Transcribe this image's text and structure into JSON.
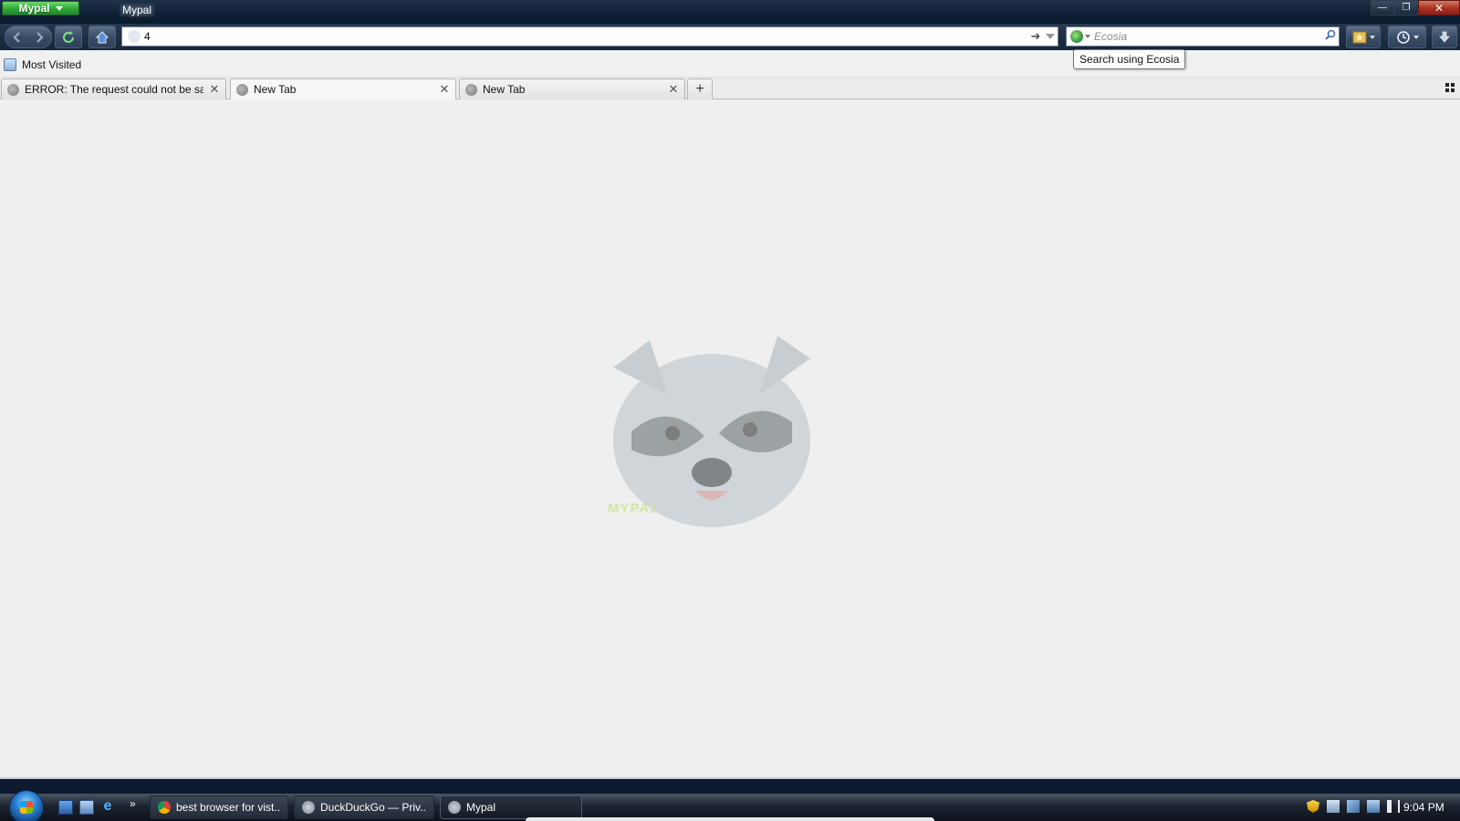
{
  "window": {
    "app_button_label": "Mypal",
    "title": "Mypal",
    "controls": {
      "minimize": "—",
      "restore": "❐",
      "close": "✕"
    }
  },
  "navbar": {
    "url_value": "4",
    "search_placeholder": "Ecosia",
    "search_tooltip": "Search using Ecosia"
  },
  "bookmarks": {
    "items": [
      {
        "label": "Most Visited",
        "icon": "bookmark-folder-icon"
      }
    ]
  },
  "tabs": [
    {
      "label": "ERROR: The request could not be sati...",
      "selected": false
    },
    {
      "label": "New Tab",
      "selected": true
    },
    {
      "label": "New Tab",
      "selected": false
    }
  ],
  "content": {
    "watermark_text": "MYPAL"
  },
  "taskbar": {
    "quick_launch_more": "»",
    "tasks": [
      {
        "label": "best browser for vist...",
        "icon": "chrome-icon"
      },
      {
        "label": "DuckDuckGo — Priv...",
        "icon": "mypal-icon"
      },
      {
        "label": "Mypal",
        "icon": "mypal-icon",
        "active": true
      }
    ],
    "clock": "9:04 PM"
  },
  "colors": {
    "accent_green": "#2fa43a",
    "content_bg": "#efefef",
    "frame_dark": "#0f2035"
  }
}
